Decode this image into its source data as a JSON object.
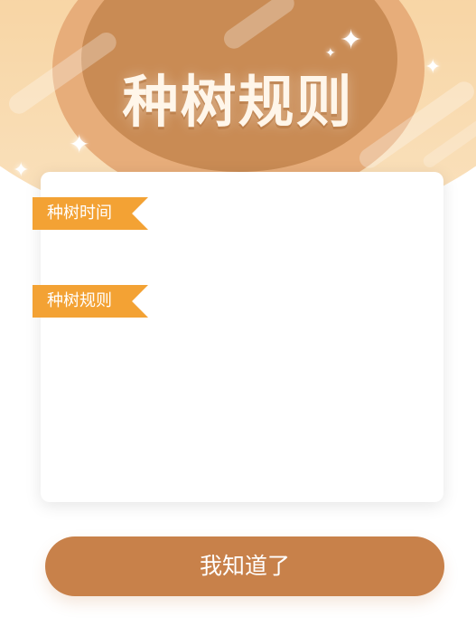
{
  "header": {
    "title": "种树规则"
  },
  "sections": [
    {
      "label": "种树时间",
      "content": ""
    },
    {
      "label": "种树规则",
      "content": ""
    }
  ],
  "footer": {
    "ok_label": "我知道了"
  },
  "colors": {
    "accent": "#f3a234",
    "button": "#c8814a",
    "header_circle": "#c98b54",
    "header_bg": "#f8d7a8"
  },
  "icons": [
    "sparkle-icon"
  ]
}
